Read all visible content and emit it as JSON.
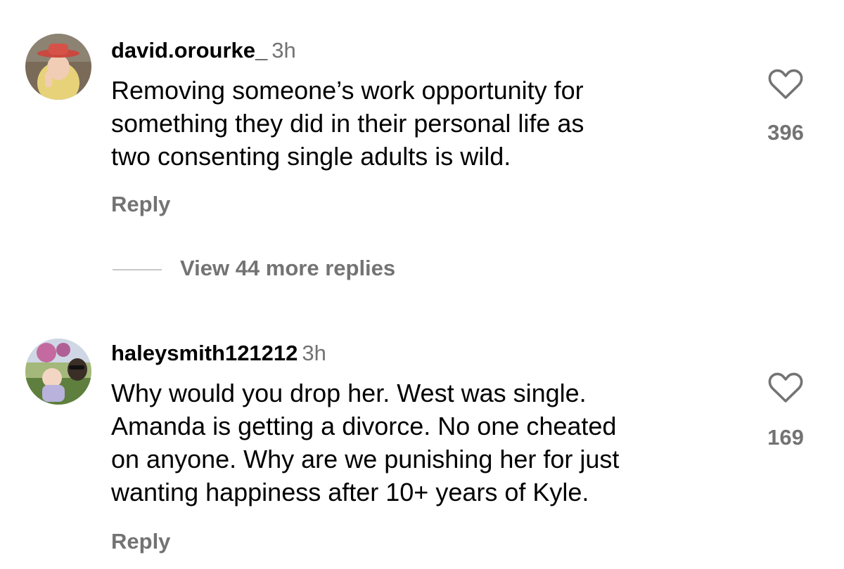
{
  "comments": [
    {
      "username": "david.orourke_",
      "timestamp": "3h",
      "lines": [
        "Removing someone’s work opportunity for",
        "something they did in their personal life as",
        "two consenting single adults is wild."
      ],
      "likes": "396",
      "reply_label": "Reply"
    },
    {
      "username": "haleysmith121212",
      "timestamp": "3h",
      "lines": [
        "Why would you drop her.  West was single.",
        "Amanda is getting a divorce.  No one cheated",
        "on anyone.  Why are we punishing her for just",
        "wanting happiness after 10+ years of Kyle."
      ],
      "likes": "169",
      "reply_label": "Reply"
    }
  ],
  "view_replies": {
    "label": "View 44 more replies"
  },
  "icons": {
    "like": "heart-outline-icon"
  },
  "colors": {
    "text": "#000000",
    "secondary": "#737373",
    "divider": "#c7c7c7"
  }
}
